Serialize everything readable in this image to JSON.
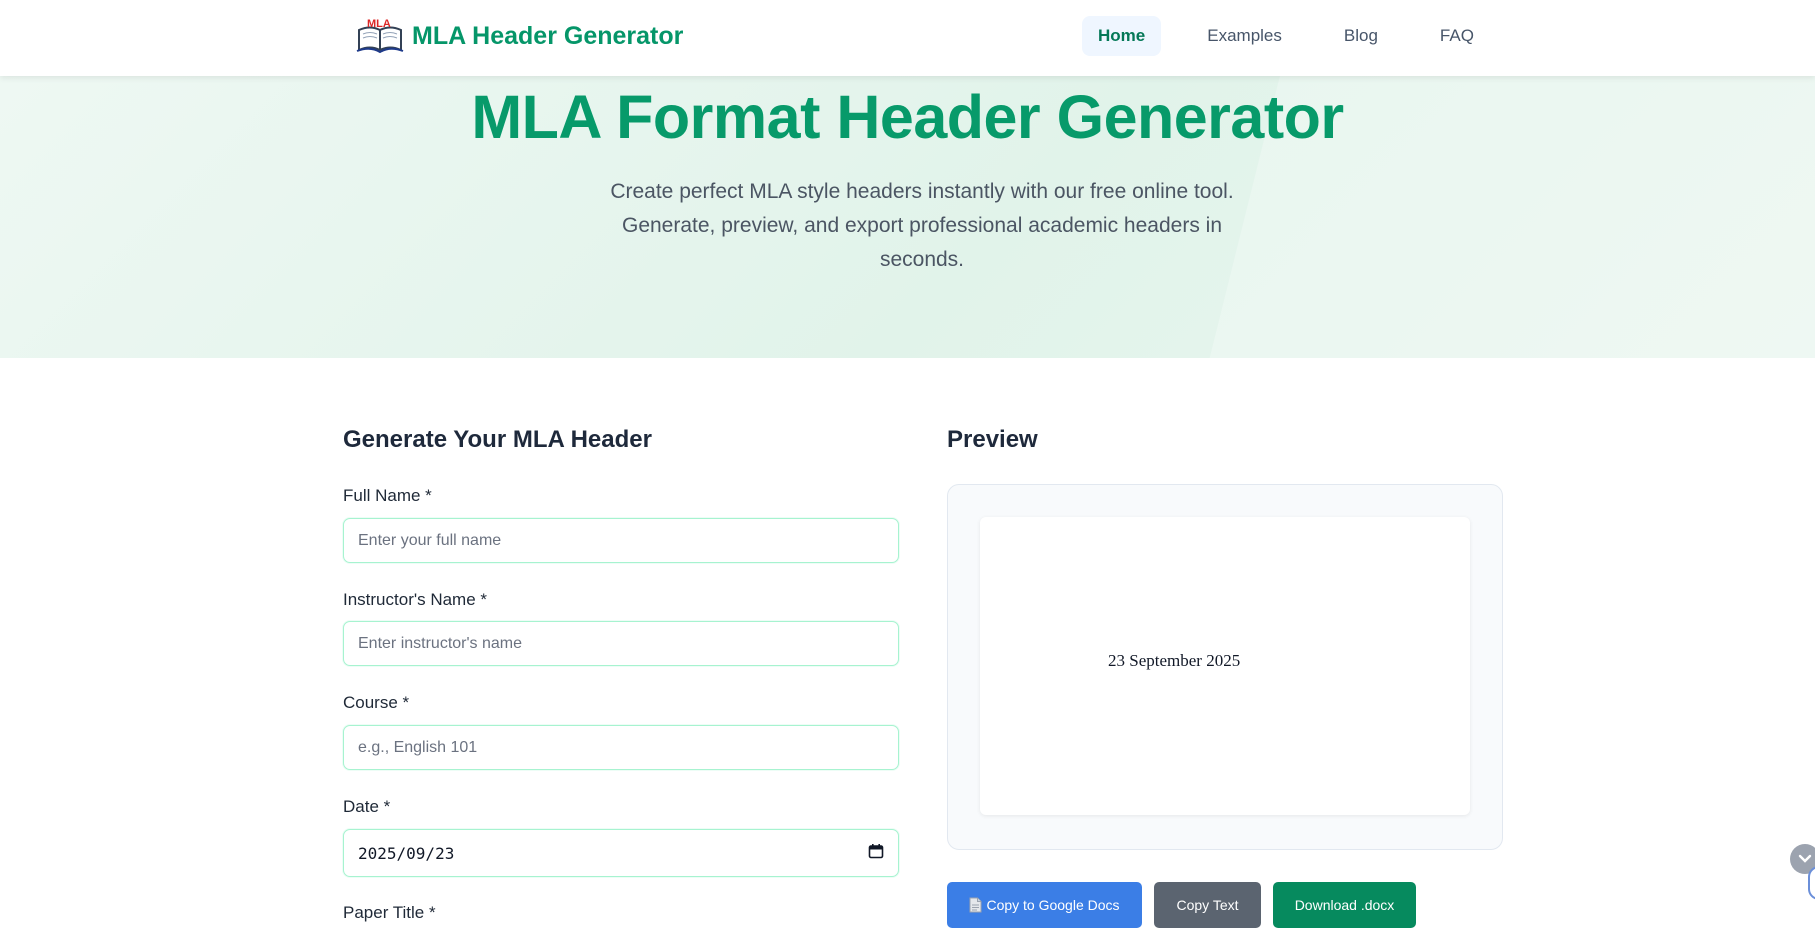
{
  "header": {
    "logo_badge": "MLA",
    "site_name": "MLA Header Generator",
    "nav": [
      {
        "label": "Home",
        "active": true
      },
      {
        "label": "Examples",
        "active": false
      },
      {
        "label": "Blog",
        "active": false
      },
      {
        "label": "FAQ",
        "active": false
      }
    ]
  },
  "hero": {
    "title": "MLA Format Header Generator",
    "subtitle": "Create perfect MLA style headers instantly with our free online tool. Generate, preview, and export professional academic headers in seconds."
  },
  "form": {
    "title": "Generate Your MLA Header",
    "fields": [
      {
        "label": "Full Name *",
        "placeholder": "Enter your full name"
      },
      {
        "label": "Instructor's Name *",
        "placeholder": "Enter instructor's name"
      },
      {
        "label": "Course *",
        "placeholder": "e.g., English 101"
      },
      {
        "label": "Date *",
        "value": "2025/09/23"
      },
      {
        "label": "Paper Title *"
      }
    ]
  },
  "preview": {
    "title": "Preview",
    "date_line": "23 September 2025",
    "buttons": {
      "google_docs": "Copy to Google Docs",
      "copy_text": "Copy Text",
      "download": "Download .docx"
    }
  },
  "colors": {
    "brand": "#059669",
    "input_border": "#a7f3d0",
    "btn_google": "#3b7ee6",
    "btn_copy": "#5b6470",
    "btn_download": "#068a5e"
  },
  "icons": {
    "logo": "open-book-icon",
    "google_docs": "document-icon",
    "calendar": "calendar-icon",
    "scroll": "chevron-down-icon"
  }
}
